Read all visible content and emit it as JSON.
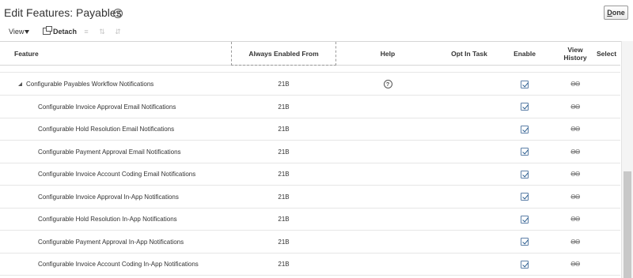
{
  "header": {
    "title": "Edit Features: Payables",
    "help_glyph": "?",
    "done_first": "D",
    "done_rest": "one"
  },
  "toolbar": {
    "view_label": "View",
    "detach_label": "Detach",
    "icons": [
      "freeze-icon",
      "wrap-icon",
      "reorder-icon"
    ]
  },
  "table": {
    "columns": {
      "feature": "Feature",
      "always_enabled": "Always Enabled From",
      "help": "Help",
      "opt_in_task": "Opt In Task",
      "enable": "Enable",
      "view_history_1": "View",
      "view_history_2": "History",
      "select": "Select"
    },
    "rows": [
      {
        "name": "Configurable Payables Workflow Notifications",
        "release": "21B",
        "help": "?",
        "enabled": true,
        "history": "ϴϴ",
        "parent": true
      },
      {
        "name": "Configurable Invoice Approval Email Notifications",
        "release": "21B",
        "help": "",
        "enabled": true,
        "history": "ϴϴ",
        "parent": false
      },
      {
        "name": "Configurable Hold Resolution Email Notifications",
        "release": "21B",
        "help": "",
        "enabled": true,
        "history": "ϴϴ",
        "parent": false
      },
      {
        "name": "Configurable Payment Approval Email Notifications",
        "release": "21B",
        "help": "",
        "enabled": true,
        "history": "ϴϴ",
        "parent": false
      },
      {
        "name": "Configurable Invoice Account Coding Email Notifications",
        "release": "21B",
        "help": "",
        "enabled": true,
        "history": "ϴϴ",
        "parent": false
      },
      {
        "name": "Configurable Invoice Approval In-App Notifications",
        "release": "21B",
        "help": "",
        "enabled": true,
        "history": "ϴϴ",
        "parent": false
      },
      {
        "name": "Configurable Hold Resolution In-App Notifications",
        "release": "21B",
        "help": "",
        "enabled": true,
        "history": "ϴϴ",
        "parent": false
      },
      {
        "name": "Configurable Payment Approval In-App Notifications",
        "release": "21B",
        "help": "",
        "enabled": true,
        "history": "ϴϴ",
        "parent": false
      },
      {
        "name": "Configurable Invoice Account Coding In-App Notifications",
        "release": "21B",
        "help": "",
        "enabled": true,
        "history": "ϴϴ",
        "parent": false
      }
    ]
  }
}
